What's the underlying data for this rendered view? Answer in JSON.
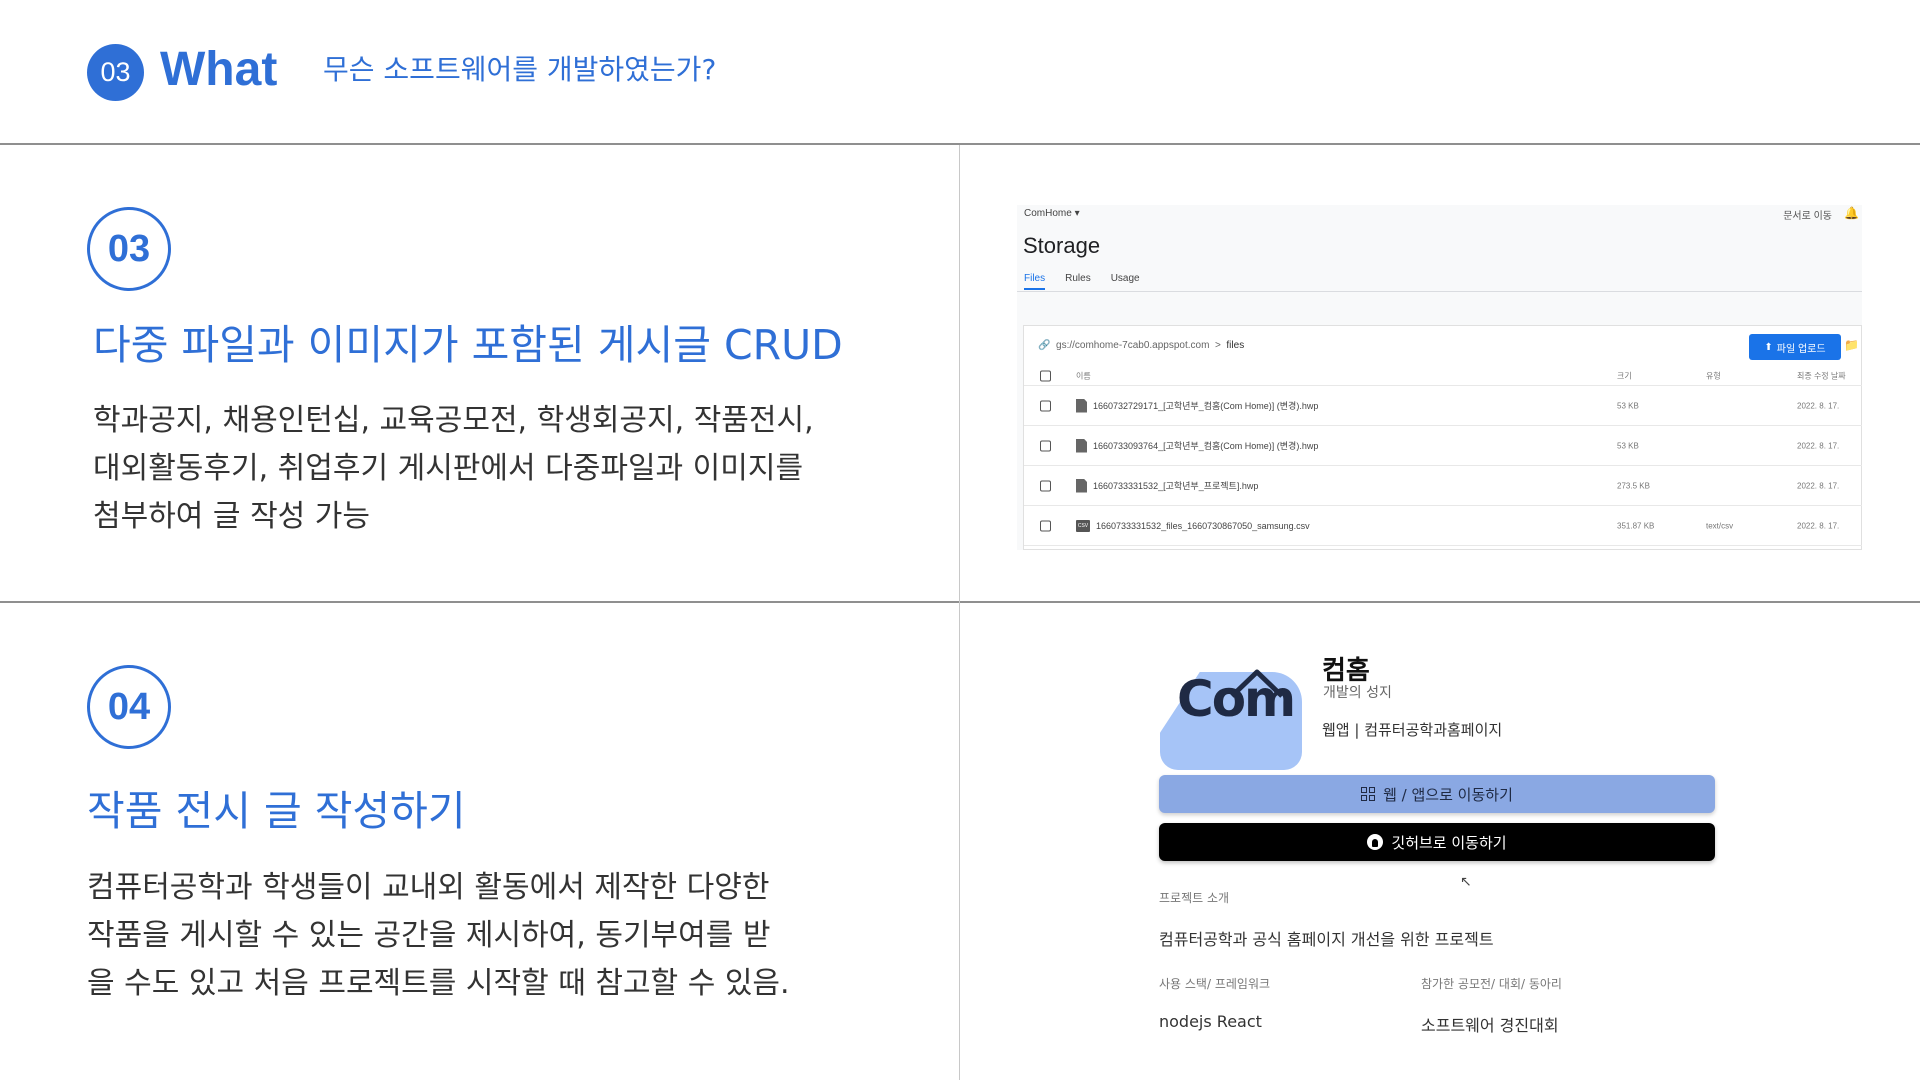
{
  "header": {
    "badge": "03",
    "title": "What",
    "subtitle": "무슨 소프트웨어를 개발하였는가?"
  },
  "section1": {
    "number": "03",
    "title": "다중 파일과 이미지가 포함된 게시글 CRUD",
    "body": [
      "학과공지, 채용인턴십, 교육공모전, 학생회공지, 작품전시,",
      "대외활동후기, 취업후기 게시판에서 다중파일과 이미지를",
      "첨부하여 글 작성 가능"
    ]
  },
  "section2": {
    "number": "04",
    "title": "작품 전시 글 작성하기",
    "body": [
      "컴퓨터공학과 학생들이 교내외 활동에서 제작한 다양한",
      "작품을 게시할 수 있는 공간을 제시하여, 동기부여를 받",
      "을 수도 있고 처음 프로젝트를 시작할 때 참고할 수 있음."
    ]
  },
  "storage": {
    "project": "ComHome ▾",
    "docs_link": "문서로 이동",
    "title": "Storage",
    "tabs": [
      "Files",
      "Rules",
      "Usage"
    ],
    "path_bucket": "gs://comhome-7cab0.appspot.com",
    "path_sep": ">",
    "path_folder": "files",
    "upload_label": "파일 업로드",
    "columns": {
      "name": "이름",
      "size": "크기",
      "type": "유형",
      "date": "최종 수정 날짜"
    },
    "files": [
      {
        "name": "1660732729171_[고학년부_컴홈(Com Home)] (변경).hwp",
        "size": "53 KB",
        "type": "",
        "date": "2022. 8. 17."
      },
      {
        "name": "1660733093764_[고학년부_컴홈(Com Home)] (변경).hwp",
        "size": "53 KB",
        "type": "",
        "date": "2022. 8. 17."
      },
      {
        "name": "1660733331532_[고학년부_프로젝트].hwp",
        "size": "273.5 KB",
        "type": "",
        "date": "2022. 8. 17."
      },
      {
        "name": "1660733331532_files_1660730867050_samsung.csv",
        "size": "351.87 KB",
        "type": "text/csv",
        "date": "2022. 8. 17."
      }
    ]
  },
  "comhome": {
    "logo_text": "Com",
    "name": "컴홈",
    "slogan": "개발의 성지",
    "category": "웹앱 | 컴퓨터공학과홈페이지",
    "btn_web": "웹 / 앱으로 이동하기",
    "btn_git": "깃허브로 이동하기",
    "intro_label": "프로젝트 소개",
    "intro_value": "컴퓨터공학과 공식 홈페이지 개선을 위한 프로젝트",
    "stack_label": "사용 스택/ 프레임워크",
    "stack_value": "nodejs React",
    "contest_label": "참가한 공모전/ 대회/ 동아리",
    "contest_value": "소프트웨어 경진대회"
  },
  "colors": {
    "accent": "#2f6fd6",
    "firebase_blue": "#1a73e8",
    "web_button": "#8aa8e3"
  }
}
